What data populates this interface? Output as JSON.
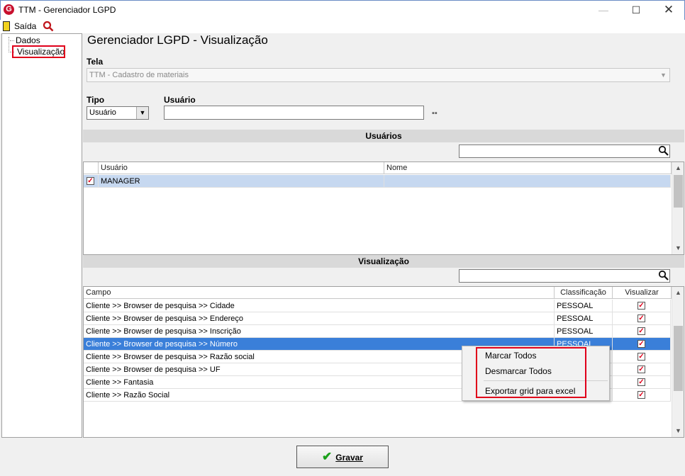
{
  "window": {
    "title": "TTM - Gerenciador LGPD",
    "icon": "app-logo-icon"
  },
  "menubar": {
    "exit_label": "Saída"
  },
  "tree": {
    "items": [
      {
        "label": "Dados"
      },
      {
        "label": "Visualização",
        "highlighted": true
      }
    ]
  },
  "page": {
    "title": "Gerenciador LGPD - Visualização"
  },
  "tela": {
    "label": "Tela",
    "value": "TTM - Cadastro de materiais"
  },
  "tipo": {
    "label": "Tipo",
    "value": "Usuário"
  },
  "usuario": {
    "label": "Usuário",
    "value": ""
  },
  "usuarios_section": {
    "title": "Usuários",
    "search_value": "",
    "columns": [
      "Usuário",
      "Nome"
    ],
    "rows": [
      {
        "checked": true,
        "usuario": "MANAGER",
        "nome": ""
      }
    ]
  },
  "visualizacao_section": {
    "title": "Visualização",
    "search_value": "",
    "columns": [
      "Campo",
      "Classificação",
      "Visualizar"
    ],
    "rows": [
      {
        "campo": "Cliente >> Browser de pesquisa >> Cidade",
        "classificacao": "PESSOAL",
        "visualizar": true
      },
      {
        "campo": "Cliente >> Browser de pesquisa >> Endereço",
        "classificacao": "PESSOAL",
        "visualizar": true
      },
      {
        "campo": "Cliente >> Browser de pesquisa >> Inscrição",
        "classificacao": "PESSOAL",
        "visualizar": true
      },
      {
        "campo": "Cliente >> Browser de pesquisa >> Número",
        "classificacao": "PESSOAL",
        "visualizar": true,
        "selected": true
      },
      {
        "campo": "Cliente >> Browser de pesquisa >> Razão social",
        "classificacao": "",
        "visualizar": true
      },
      {
        "campo": "Cliente >> Browser de pesquisa >> UF",
        "classificacao": "",
        "visualizar": true
      },
      {
        "campo": "Cliente >> Fantasia",
        "classificacao": "",
        "visualizar": true
      },
      {
        "campo": "Cliente >> Razão Social",
        "classificacao": "",
        "visualizar": true
      }
    ]
  },
  "context_menu": {
    "items": [
      "Marcar Todos",
      "Desmarcar Todos",
      "Exportar grid para excel"
    ]
  },
  "footer": {
    "save_label": "Gravar"
  },
  "colors": {
    "selection": "#3a7fd9",
    "highlight_border": "#e0001a",
    "check": "#e0001a"
  }
}
